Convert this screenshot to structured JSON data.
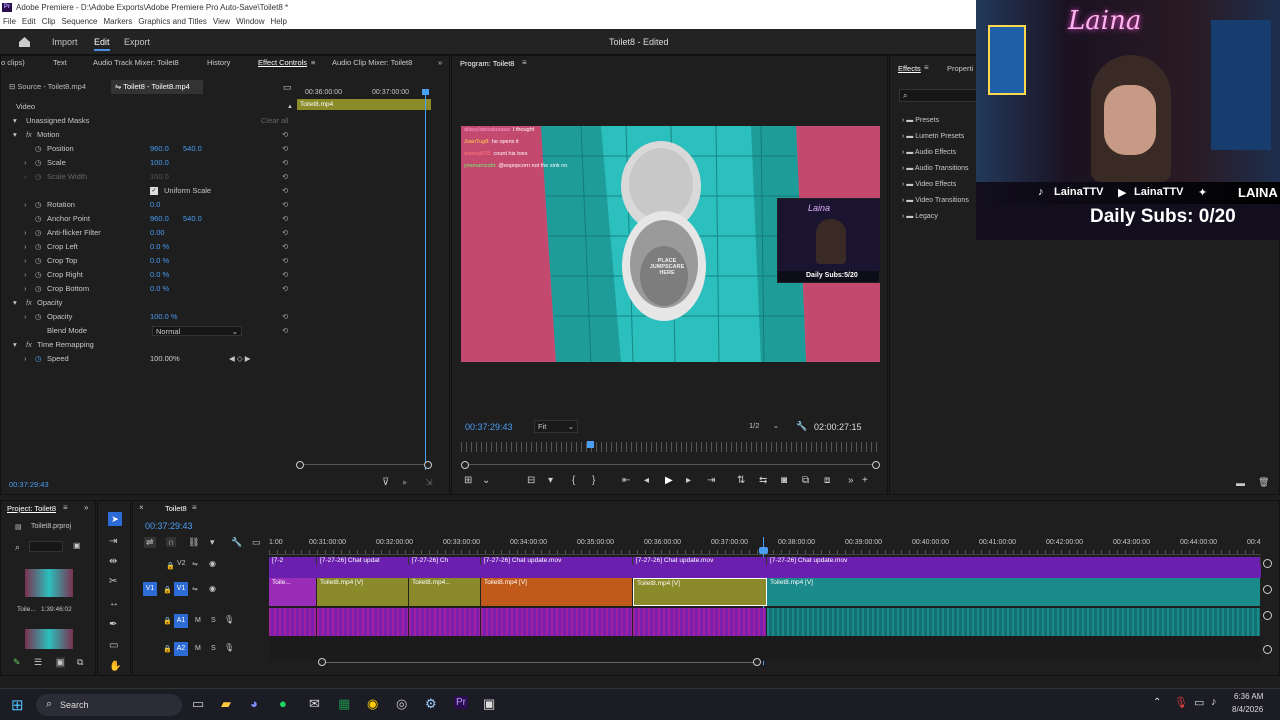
{
  "app": {
    "title": "Adobe Premiere - D:\\Adobe Exports\\Adobe Premiere Pro Auto-Save\\Toilet8 *",
    "menu": [
      "File",
      "Edit",
      "Clip",
      "Sequence",
      "Markers",
      "Graphics and Titles",
      "View",
      "Window",
      "Help"
    ],
    "workspaces": {
      "import": "Import",
      "edit": "Edit",
      "export": "Export"
    },
    "doc_title": "Toilet8 - Edited"
  },
  "panels_tabs": {
    "no_clips": "o clips)",
    "text": "Text",
    "audio_track_mixer": "Audio Track Mixer: Toilet8",
    "history": "History",
    "effect_controls": "Effect Controls",
    "audio_clip_mixer": "Audio Clip Mixer: Toilet8",
    "program": "Program: Toilet8",
    "effects": "Effects",
    "properties": "Properti"
  },
  "effect_controls": {
    "source_tab": "Source - Toilet8.mp4",
    "seq_tab": "Toilet8 - Toilet8.mp4",
    "ruler": [
      "00:36:00:00",
      "00:37:00:00"
    ],
    "clip_label": "Toilet8.mp4",
    "section_video": "Video",
    "unassigned_masks": "Unassigned Masks",
    "clear_all": "Clear all",
    "motion": "Motion",
    "position": {
      "label": "Position",
      "x": "960.0",
      "y": "540.0"
    },
    "scale": {
      "label": "Scale",
      "value": "100.0"
    },
    "scale_width": {
      "label": "Scale Width",
      "value": "100.0"
    },
    "uniform_scale": "Uniform Scale",
    "rotation": {
      "label": "Rotation",
      "value": "0.0"
    },
    "anchor": {
      "label": "Anchor Point",
      "x": "960.0",
      "y": "540.0"
    },
    "antiflicker": {
      "label": "Anti-flicker Filter",
      "value": "0.00"
    },
    "crop_left": {
      "label": "Crop Left",
      "value": "0.0 %"
    },
    "crop_top": {
      "label": "Crop Top",
      "value": "0.0 %"
    },
    "crop_right": {
      "label": "Crop Right",
      "value": "0.0 %"
    },
    "crop_bottom": {
      "label": "Crop Bottom",
      "value": "0.0 %"
    },
    "opacity_section": "Opacity",
    "opacity": {
      "label": "Opacity",
      "value": "100.0 %"
    },
    "blend_mode": {
      "label": "Blend Mode",
      "value": "Normal"
    },
    "time_remapping": "Time Remapping",
    "speed": {
      "label": "Speed",
      "value": "100.00%"
    },
    "timecode": "00:37:29:43"
  },
  "program": {
    "timecode": "00:37:29:43",
    "fit": "Fit",
    "resolution": "1/2",
    "duration": "02:00:27:15",
    "chat": [
      {
        "user": "atlasylatesalaxaaa:",
        "msg": "I thought",
        "color": "#ff9ad5"
      },
      {
        "user": "JuanTug8:",
        "msg": "he opens it",
        "color": "#ffd34d"
      },
      {
        "user": "antdog878:",
        "msg": "count his toes",
        "color": "#ff7a7a"
      },
      {
        "user": "yesmamcobi:",
        "msg": "@eopopcorn not the sink no",
        "color": "#6cf06c"
      }
    ],
    "seat_text": "PLACE JUMPSCARE HERE",
    "pip_name": "Laina",
    "pip_subs": "Daily Subs:5/20"
  },
  "effects": {
    "search_placeholder": "",
    "items": [
      "Presets",
      "Lumetri Presets",
      "Audio Effects",
      "Audio Transitions",
      "Video Effects",
      "Video Transitions",
      "Legacy"
    ]
  },
  "webcam": {
    "name": "Laina",
    "socials": [
      "LainaTTV",
      "LainaTTV",
      "LAINA"
    ],
    "subs": "Daily Subs: 0/20"
  },
  "project": {
    "tab": "Project: Toilet8",
    "file": "Toilet8.prproj",
    "clip_name": "Toile...",
    "clip_dur": "1:39:46:02"
  },
  "timeline": {
    "tab": "Toilet8",
    "timecode": "00:37:29:43",
    "ruler": [
      "00:31:00:00",
      "00:32:00:00",
      "00:33:00:00",
      "00:34:00:00",
      "00:35:00:00",
      "00:36:00:00",
      "00:37:00:00",
      "00:38:00:00",
      "00:39:00:00",
      "00:40:00:00",
      "00:41:00:00",
      "00:42:00:00",
      "00:43:00:00",
      "00:44:00:00",
      "00:4"
    ],
    "ruler_first": "1:00",
    "tracks": {
      "v2": "V2",
      "v1": "V1",
      "a1": "A1",
      "a2": "A2"
    },
    "v2_clips": [
      "[7-2",
      "[7-27-26] Chat updat",
      "[7-27-26] Ch",
      "[7-27-26] Chat update.mov",
      "[7-27-26] Chat update.mov",
      "[7-27-26] Chat update.mov"
    ],
    "v1_clips": [
      "Toile...",
      "Toilet8.mp4 [V]",
      "Toilet8.mp4...",
      "Toilet8.mp4 [V]",
      "Toilet8.mp4 [V]",
      "Toilet8.mp4 [V]"
    ]
  },
  "taskbar": {
    "search": "Search",
    "time": "6:36 AM",
    "date": "8/4/2026"
  },
  "colors": {
    "accent": "#4a9ef5",
    "purple": "#7b2fbe",
    "olive": "#8a8a2a",
    "orange": "#c05a1a",
    "teal": "#1a8a8a"
  }
}
